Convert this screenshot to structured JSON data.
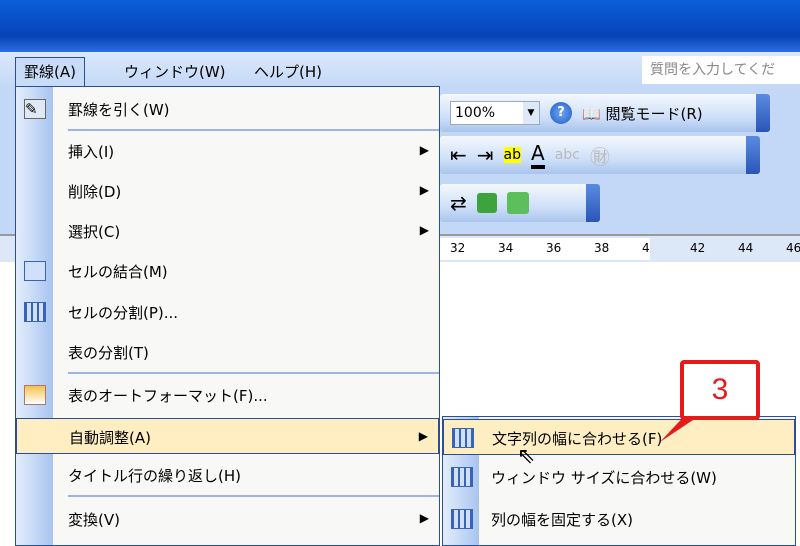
{
  "menubar": {
    "items": [
      "罫線(A)",
      "ウィンドウ(W)",
      "ヘルプ(H)"
    ],
    "search_placeholder": "質問を入力してくだ"
  },
  "toolbar": {
    "zoom": "100%",
    "reading_mode": "閲覧モード(R)",
    "help_icon": "?"
  },
  "ruler": [
    "32",
    "34",
    "36",
    "38",
    "4",
    "42",
    "44",
    "46"
  ],
  "table_menu": {
    "items": [
      {
        "label": "罫線を引く(W)"
      },
      {
        "label": "挿入(I)",
        "submenu": true
      },
      {
        "label": "削除(D)",
        "submenu": true
      },
      {
        "label": "選択(C)",
        "submenu": true
      },
      {
        "label": "セルの結合(M)"
      },
      {
        "label": "セルの分割(P)..."
      },
      {
        "label": "表の分割(T)"
      },
      {
        "label": "表のオートフォーマット(F)..."
      },
      {
        "label": "自動調整(A)",
        "submenu": true,
        "highlighted": true
      },
      {
        "label": "タイトル行の繰り返し(H)"
      },
      {
        "label": "変換(V)",
        "submenu": true
      }
    ]
  },
  "autofit_submenu": {
    "items": [
      {
        "label": "文字列の幅に合わせる(F)",
        "highlighted": true
      },
      {
        "label": "ウィンドウ サイズに合わせる(W)"
      },
      {
        "label": "列の幅を固定する(X)"
      }
    ]
  },
  "callout": {
    "label": "3",
    "color": "#e51a1a"
  }
}
